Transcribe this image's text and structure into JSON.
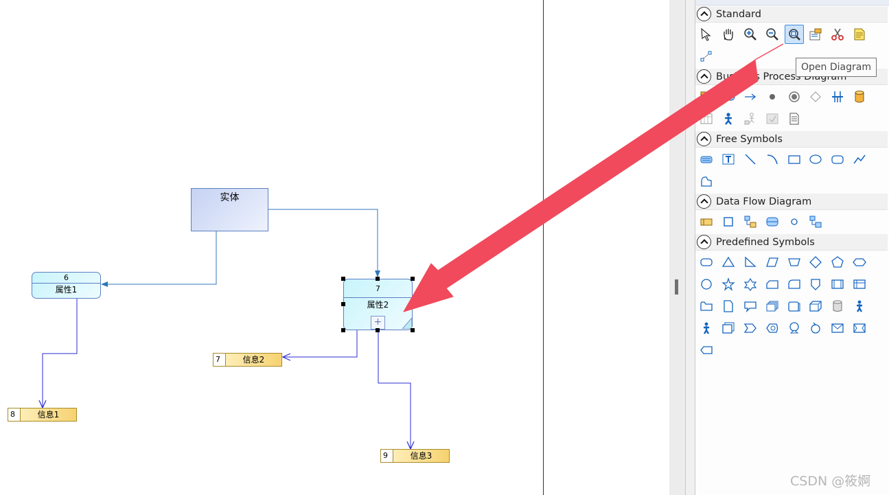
{
  "diagram": {
    "entity": {
      "label": "实体"
    },
    "processes": [
      {
        "id": "6",
        "label": "属性1"
      },
      {
        "id": "7",
        "label": "属性2"
      }
    ],
    "stores": [
      {
        "id": "7",
        "label": "信息2"
      },
      {
        "id": "8",
        "label": "信息1"
      },
      {
        "id": "9",
        "label": "信息3"
      }
    ],
    "colors": {
      "link": "#3b6fb6",
      "flow": "#2b2bd6",
      "callout_arrow": "#f04a5c"
    }
  },
  "toolbox": {
    "sections": [
      {
        "title": "Standard",
        "tools": [
          "pointer-icon",
          "hand-icon",
          "zoom-in-icon",
          "zoom-out-icon",
          "open-diagram-icon",
          "properties-icon",
          "cut-icon",
          "notes-icon",
          "link-icon"
        ]
      },
      {
        "title": "Business Process Diagram",
        "tools": [
          "package-icon",
          "process-icon",
          "flow-icon",
          "start-icon",
          "end-icon",
          "decision-icon",
          "synchronization-icon",
          "resource-icon",
          "swimlane-icon",
          "organization-unit-icon",
          "actor-icon",
          "file-object-icon",
          "document-icon"
        ]
      },
      {
        "title": "Free Symbols",
        "tools": [
          "title-icon",
          "text-icon",
          "line-icon",
          "arc-icon",
          "rectangle-icon",
          "ellipse-icon",
          "rounded-rectangle-icon",
          "polyline-icon",
          "polygon-icon"
        ]
      },
      {
        "title": "Data Flow Diagram",
        "tools": [
          "data-store-icon",
          "process-square-icon",
          "split-merge-icon",
          "flow-process-icon",
          "circle-icon",
          "link-flow-icon"
        ]
      },
      {
        "title": "Predefined Symbols",
        "tools": [
          "rounded-box-icon",
          "triangle-icon",
          "right-triangle-icon",
          "parallelogram-icon",
          "trapezoid-icon",
          "diamond-icon",
          "pentagon-icon",
          "hexagon-icon",
          "circle-shape-icon",
          "star-icon",
          "six-star-icon",
          "card-icon",
          "rounded-card-icon",
          "shield-icon",
          "frame-icon",
          "table-icon",
          "folder-icon",
          "page-icon",
          "speech-icon",
          "stack-icon",
          "box-3d-icon",
          "cube-icon",
          "cylinder-icon",
          "person-icon",
          "person-2-icon",
          "window-icon",
          "chevron-icon",
          "scroll-icon",
          "balloon-icon",
          "circular-arrow-icon",
          "envelope-icon",
          "ticket-icon",
          "tag-icon"
        ]
      }
    ],
    "tooltip": "Open Diagram"
  },
  "watermark": "CSDN @筱婀"
}
